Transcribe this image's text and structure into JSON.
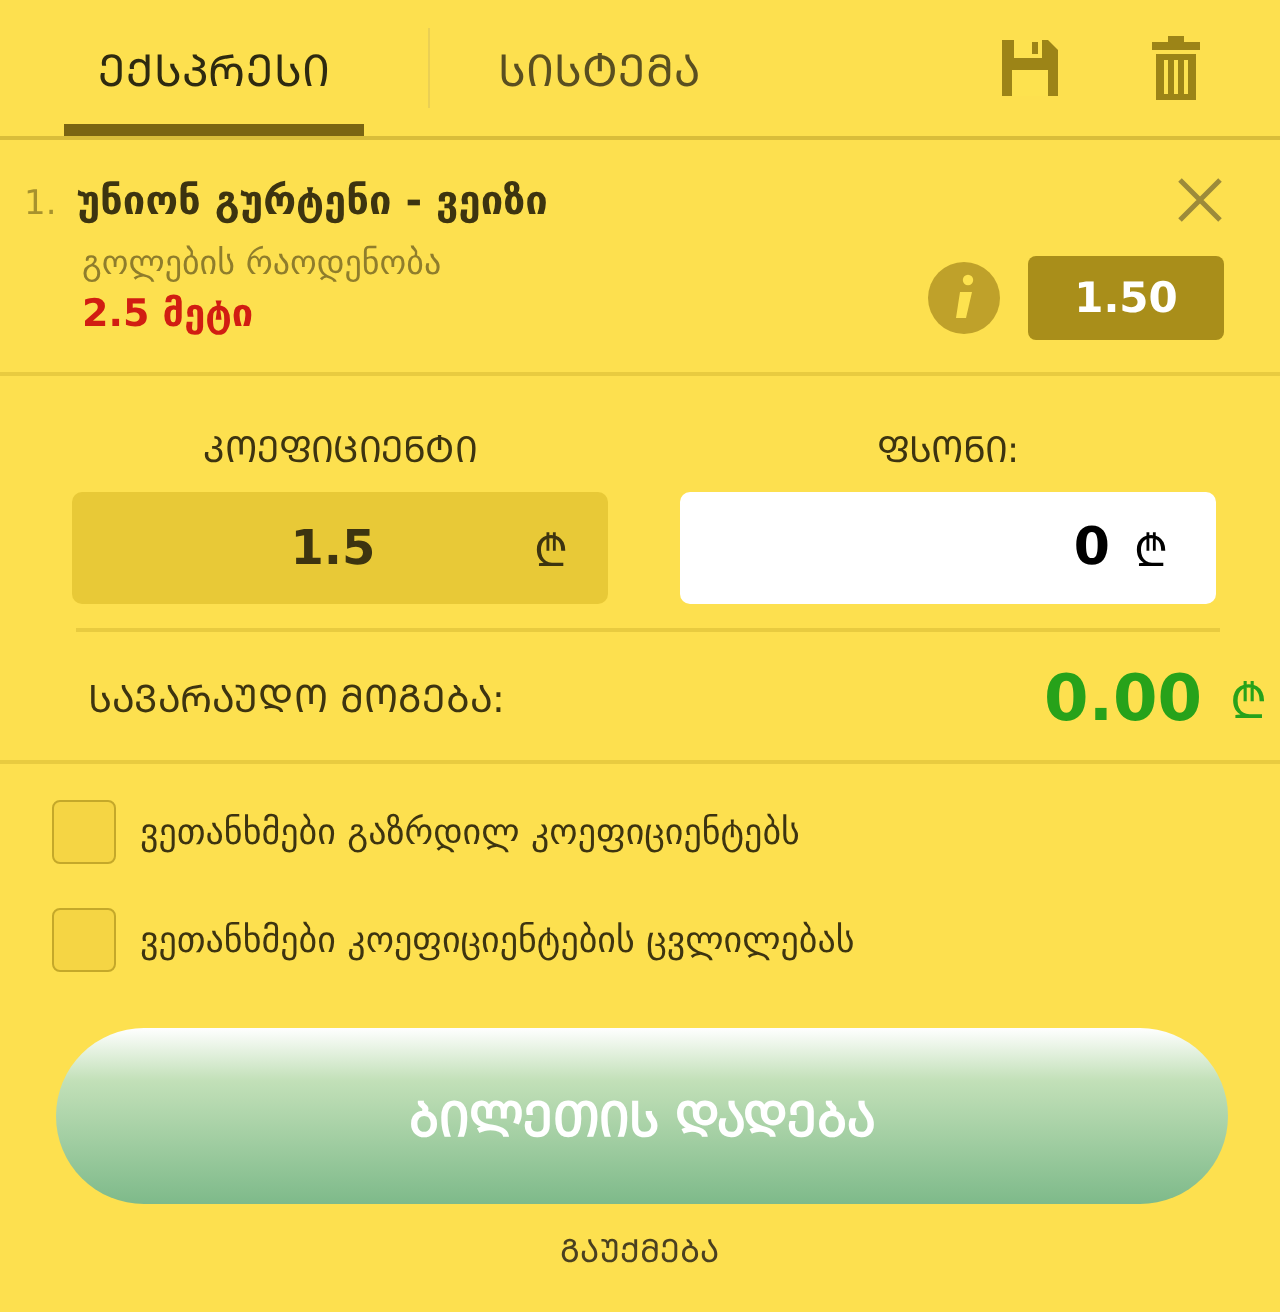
{
  "tabs": [
    {
      "label": "ᲔᲥᲡᲞᲠᲔᲡᲘ",
      "selected": true
    },
    {
      "label": "ᲡᲘᲡᲢᲔᲛᲐ",
      "selected": false
    }
  ],
  "bets": [
    {
      "number": "1.",
      "match": "უნიონ გურტენი - ვეიზი",
      "market": "გოლების რაოდენობა",
      "outcome": "2.5 მეტი",
      "odds": "1.50"
    }
  ],
  "coefficient": {
    "label": "ᲙᲝᲔᲤᲘᲪᲘᲔᲜᲢᲘ",
    "value": "1.5",
    "currency": "₾"
  },
  "stake": {
    "label": "ᲤᲡᲝᲜᲘ:",
    "value": "0",
    "currency": "₾"
  },
  "potential_win": {
    "label": "ᲡᲐᲕᲐᲠᲐᲣᲓᲝ ᲛᲝᲒᲔᲑᲐ:",
    "value": "0.00",
    "currency": "₾"
  },
  "options": [
    {
      "label": "ვეთანხმები გაზრდილ კოეფიციენტებს",
      "checked": false
    },
    {
      "label": "ვეთანხმები კოეფიციენტების ცვლილებას",
      "checked": false
    }
  ],
  "place_button": "ᲑᲘᲚᲔᲗᲘᲡ ᲓᲐᲓᲔᲑᲐ",
  "cancel_link": "ᲒᲐᲣᲥᲛᲔᲑᲐ"
}
